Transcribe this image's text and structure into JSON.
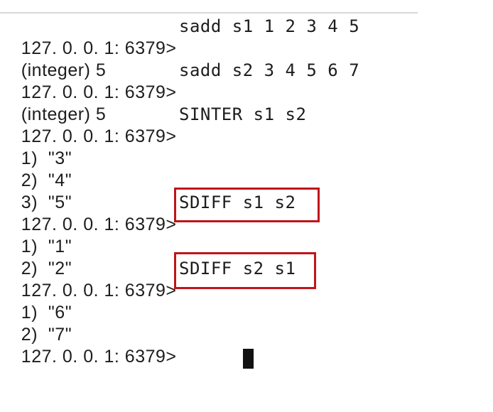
{
  "terminal": {
    "prompt": "127. 0. 0. 1: 6379>",
    "lines": [
      {
        "kind": "cmd",
        "text": "sadd s1 1 2 3 4 5"
      },
      {
        "kind": "out",
        "text": "(integer) 5"
      },
      {
        "kind": "cmd",
        "text": "sadd s2 3 4 5 6 7"
      },
      {
        "kind": "out",
        "text": "(integer) 5"
      },
      {
        "kind": "cmd",
        "text": "SINTER s1 s2"
      },
      {
        "kind": "out",
        "text": "1)  \"3\""
      },
      {
        "kind": "out",
        "text": "2)  \"4\""
      },
      {
        "kind": "out",
        "text": "3)  \"5\""
      },
      {
        "kind": "cmd",
        "text": "SDIFF s1 s2"
      },
      {
        "kind": "out",
        "text": "1)  \"1\""
      },
      {
        "kind": "out",
        "text": "2)  \"2\""
      },
      {
        "kind": "cmd",
        "text": "SDIFF s2 s1"
      },
      {
        "kind": "out",
        "text": "1)  \"6\""
      },
      {
        "kind": "out",
        "text": "2)  \"7\""
      },
      {
        "kind": "cursor",
        "text": ""
      }
    ]
  },
  "highlight_color": "#c0141a",
  "cursor_color": "#111111"
}
